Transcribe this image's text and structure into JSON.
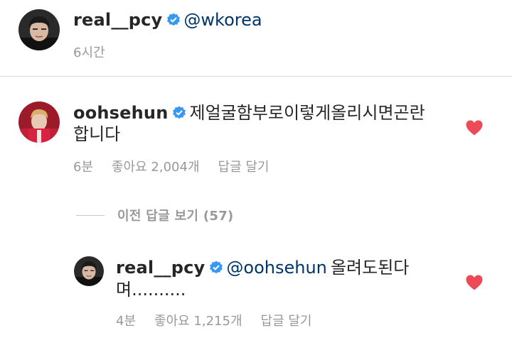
{
  "post": {
    "username": "real__pcy",
    "mention": "@wkorea",
    "time": "6시간"
  },
  "comment": {
    "username": "oohsehun",
    "text_line1": "제얼굴함부로이렇게올리시면곤란",
    "text_line2": "합니다",
    "time": "6분",
    "likes": "좋아요 2,004개",
    "reply_label": "답글 달기"
  },
  "view_replies": {
    "label": "이전 답글 보기 (57)"
  },
  "reply": {
    "username": "real__pcy",
    "mention": "@oohsehun",
    "text_line1_after_mention": "올려도된다",
    "text_line2": "며..........",
    "time": "4분",
    "likes": "좋아요 1,215개",
    "reply_label": "답글 달기"
  },
  "colors": {
    "verified_blue": "#3897f0",
    "heart_red": "#ed4956",
    "mention_blue": "#003569",
    "meta_gray": "#999999"
  },
  "icons": {
    "verified": "verified-badge-icon",
    "heart": "heart-filled-icon"
  }
}
